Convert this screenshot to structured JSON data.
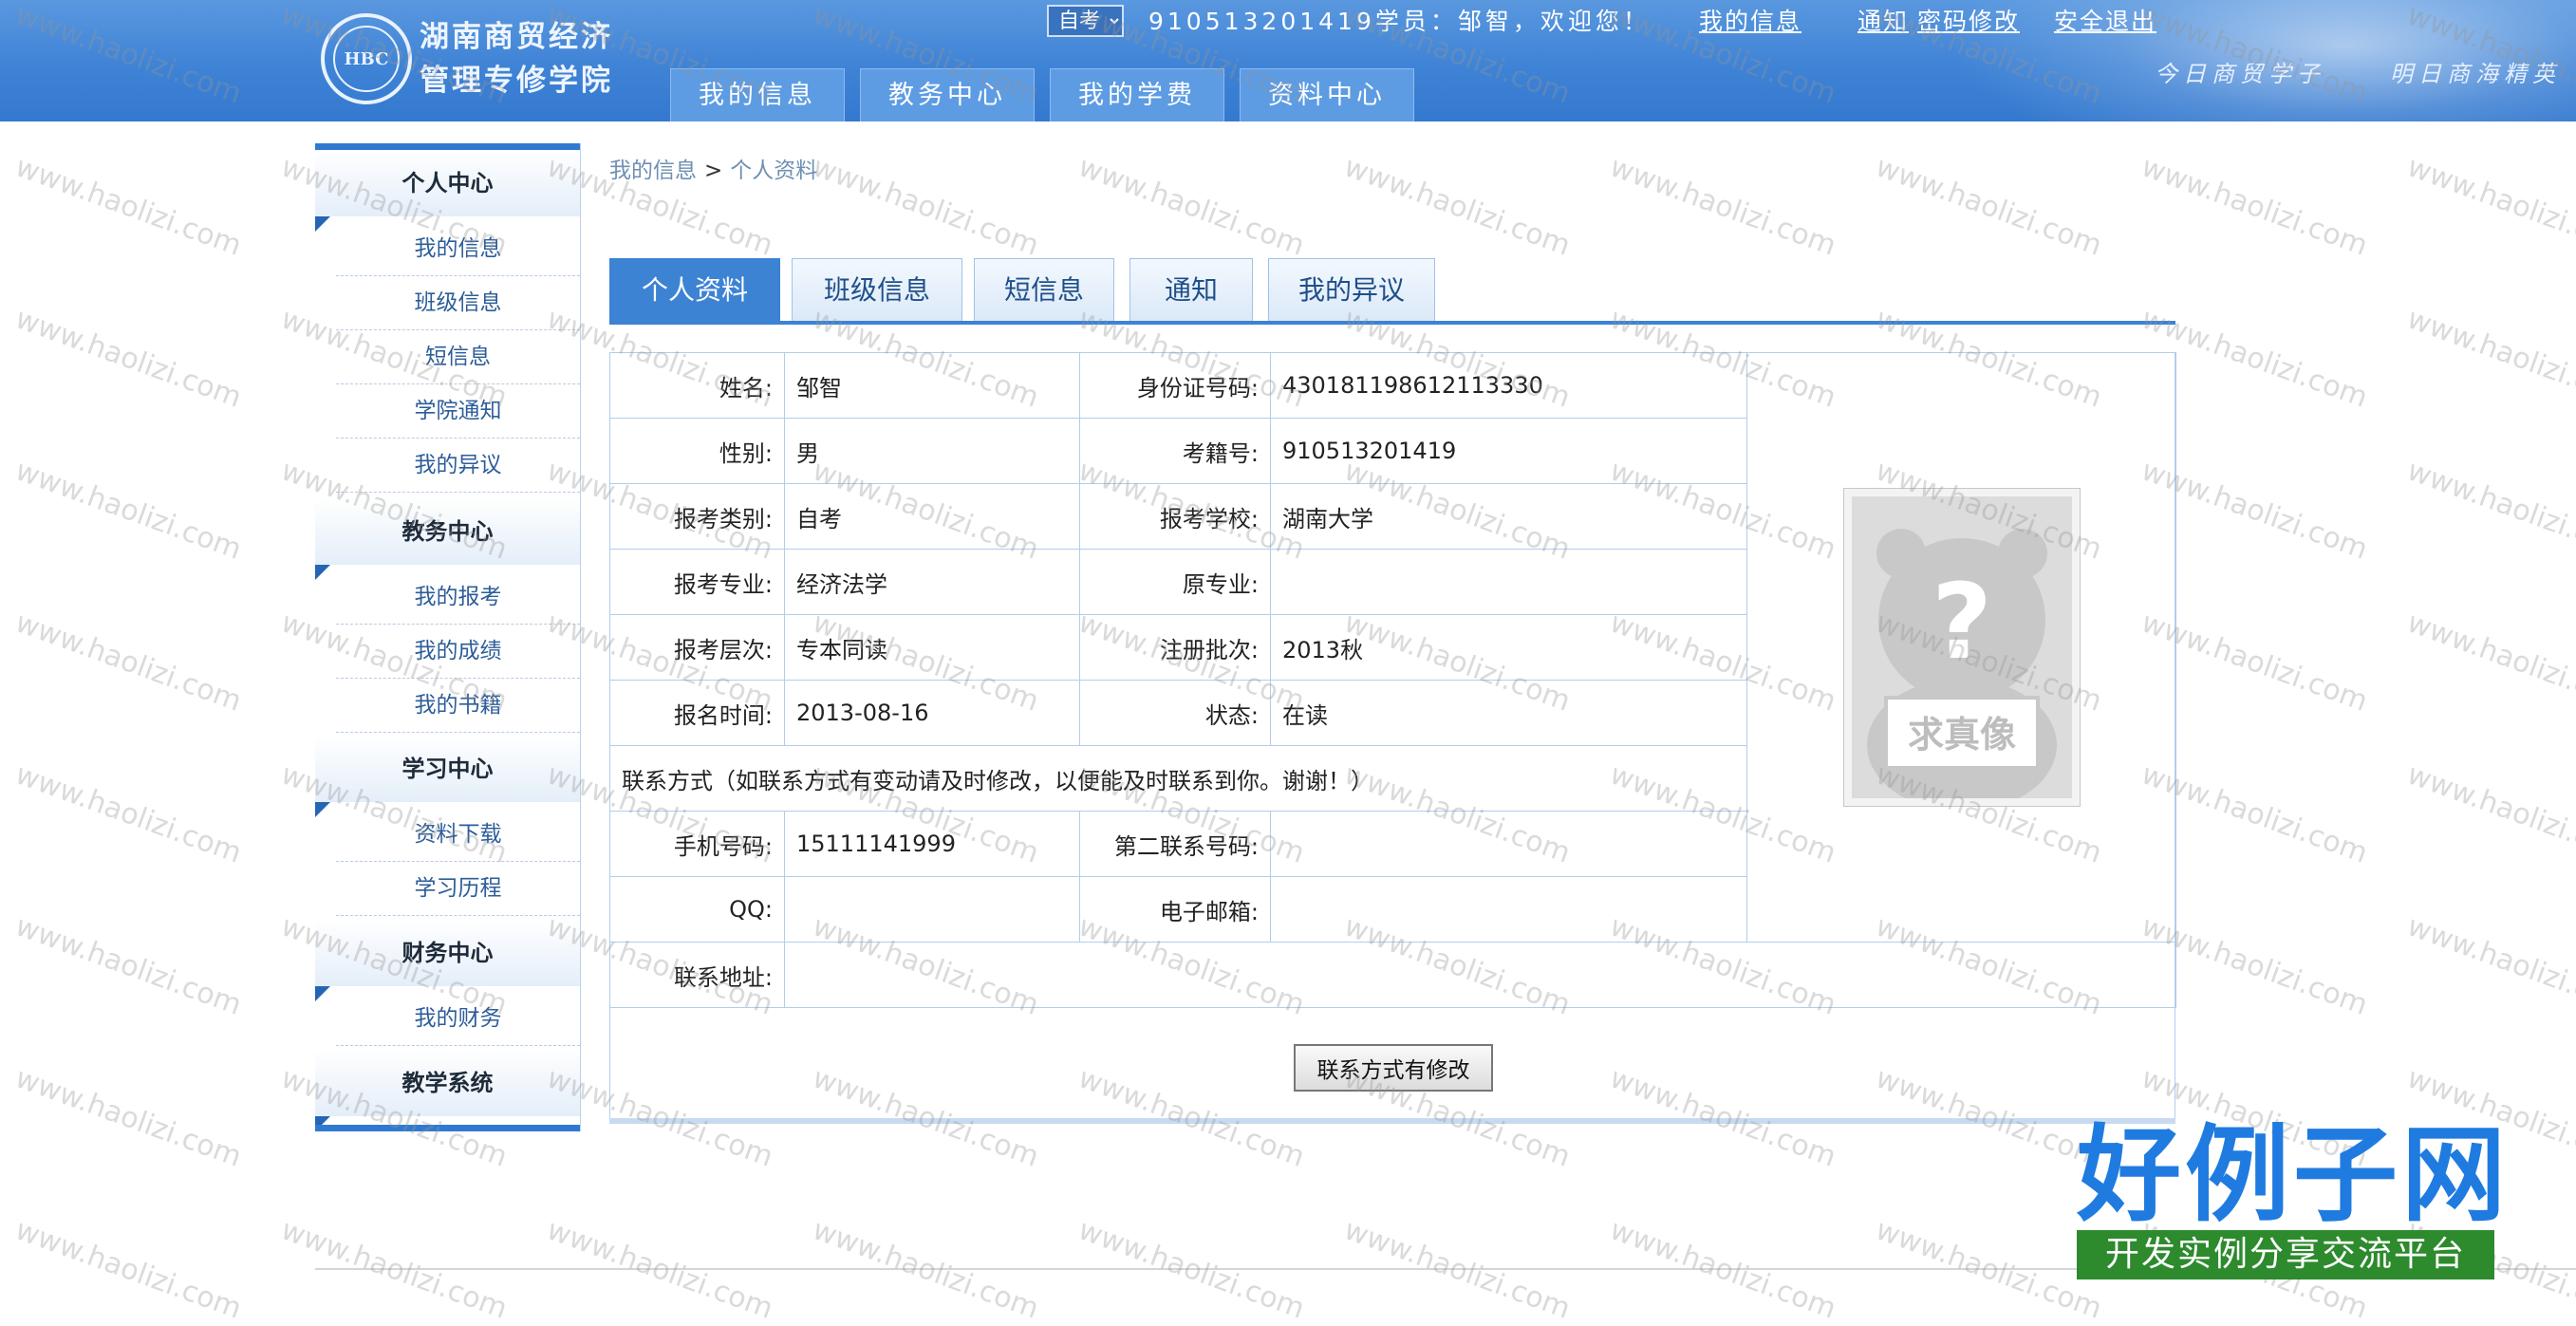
{
  "header": {
    "logo_text": "HBC",
    "school_name_line1": "湖南商贸经济",
    "school_name_line2": "管理专修学院",
    "exam_type_selected": "自考",
    "user_greeting": "910513201419学员：邹智，欢迎您！",
    "links": [
      "我的信息",
      "通知",
      "密码修改",
      "安全退出"
    ],
    "slogan_left": "今日商贸学子",
    "slogan_right": "明日商海精英",
    "nav_tabs": [
      "我的信息",
      "教务中心",
      "我的学费",
      "资料中心"
    ]
  },
  "sidebar": {
    "groups": [
      {
        "title": "个人中心",
        "items": [
          "我的信息",
          "班级信息",
          "短信息",
          "学院通知",
          "我的异议"
        ]
      },
      {
        "title": "教务中心",
        "items": [
          "我的报考",
          "我的成绩",
          "我的书籍"
        ]
      },
      {
        "title": "学习中心",
        "items": [
          "资料下载",
          "学习历程"
        ]
      },
      {
        "title": "财务中心",
        "items": [
          "我的财务"
        ]
      },
      {
        "title": "教学系统",
        "items": []
      }
    ]
  },
  "breadcrumb": {
    "first": "我的信息",
    "separator": ">",
    "current": "个人资料"
  },
  "tabs": [
    "个人资料",
    "班级信息",
    "短信息",
    "通知",
    "我的异议"
  ],
  "active_tab": "个人资料",
  "profile": {
    "name_label": "姓名:",
    "name": "邹智",
    "id_label": "身份证号码:",
    "id": "430181198612113330",
    "gender_label": "性别:",
    "gender": "男",
    "exam_no_label": "考籍号:",
    "exam_no": "910513201419",
    "exam_category_label": "报考类别:",
    "exam_category": "自考",
    "school_label": "报考学校:",
    "school": "湖南大学",
    "major_label": "报考专业:",
    "major": "经济法学",
    "orig_major_label": "原专业:",
    "orig_major": "",
    "level_label": "报考层次:",
    "level": "专本同读",
    "batch_label": "注册批次:",
    "batch": "2013秋",
    "signup_time_label": "报名时间:",
    "signup_time": "2013-08-16",
    "status_label": "状态:",
    "status": "在读",
    "photo_text": "求真像"
  },
  "contact": {
    "notice": "联系方式（如联系方式有变动请及时修改，以便能及时联系到你。谢谢！）",
    "phone_label": "手机号码:",
    "phone": "15111141999",
    "phone2_label": "第二联系号码:",
    "phone2": "",
    "qq_label": "QQ:",
    "qq": "",
    "email_label": "电子邮箱:",
    "email": "",
    "address_label": "联系地址:",
    "address": "",
    "modify_button": "联系方式有修改"
  },
  "watermark": {
    "text": "www.haolizi.com"
  },
  "brand": {
    "title": "好例子网",
    "subtitle": "开发实例分享交流平台"
  },
  "colors": {
    "header_blue": "#3f83d6",
    "active_tab": "#3c83d4",
    "link_blue": "#2d5d99"
  }
}
